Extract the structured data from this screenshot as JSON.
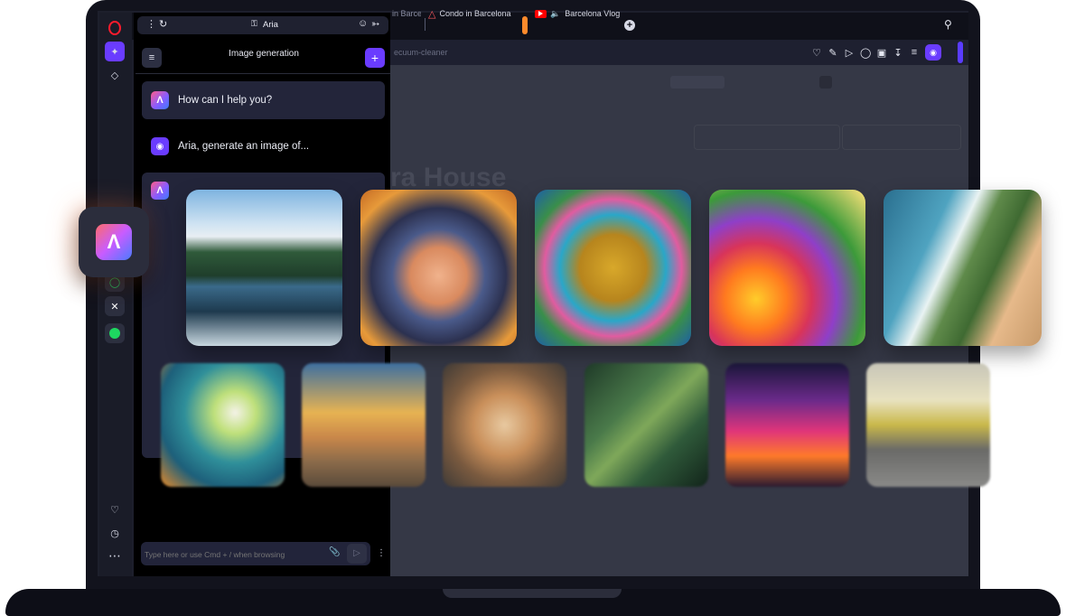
{
  "tabs": [
    {
      "label": "in Barce"
    },
    {
      "label": "Condo in Barcelona"
    },
    {
      "label": "Barcelona Vlog"
    }
  ],
  "panel": {
    "address_title": "Aria",
    "header_title": "Image generation",
    "messages": [
      {
        "role": "aria",
        "text": "How can I help you?"
      },
      {
        "role": "user",
        "text": "Aria, generate an image of..."
      }
    ],
    "input_placeholder": "Type here or use Cmd + / when browsing"
  },
  "address_bar": {
    "url_fragment": "ecuum-cleaner"
  },
  "page_background": {
    "heading_fragment": "ra House"
  },
  "icons": {
    "opera_logo": "opera-o-icon",
    "aria": "aria-logo-icon",
    "youtube": "youtube-icon",
    "airbnb": "airbnb-icon"
  },
  "accent_color": "#6a3cff",
  "generated_images": [
    {
      "subject": "mountain-lake"
    },
    {
      "subject": "anime-girl-portrait"
    },
    {
      "subject": "giraffe-with-birds"
    },
    {
      "subject": "wildflower-field-with-bees"
    },
    {
      "subject": "coastline-holding-hands"
    },
    {
      "subject": "water-lilies-koi"
    },
    {
      "subject": "city-dome-sunset"
    },
    {
      "subject": "fluffy-kitten"
    },
    {
      "subject": "palm-leaf"
    },
    {
      "subject": "neon-city-street"
    },
    {
      "subject": "cubist-mural-room"
    }
  ]
}
